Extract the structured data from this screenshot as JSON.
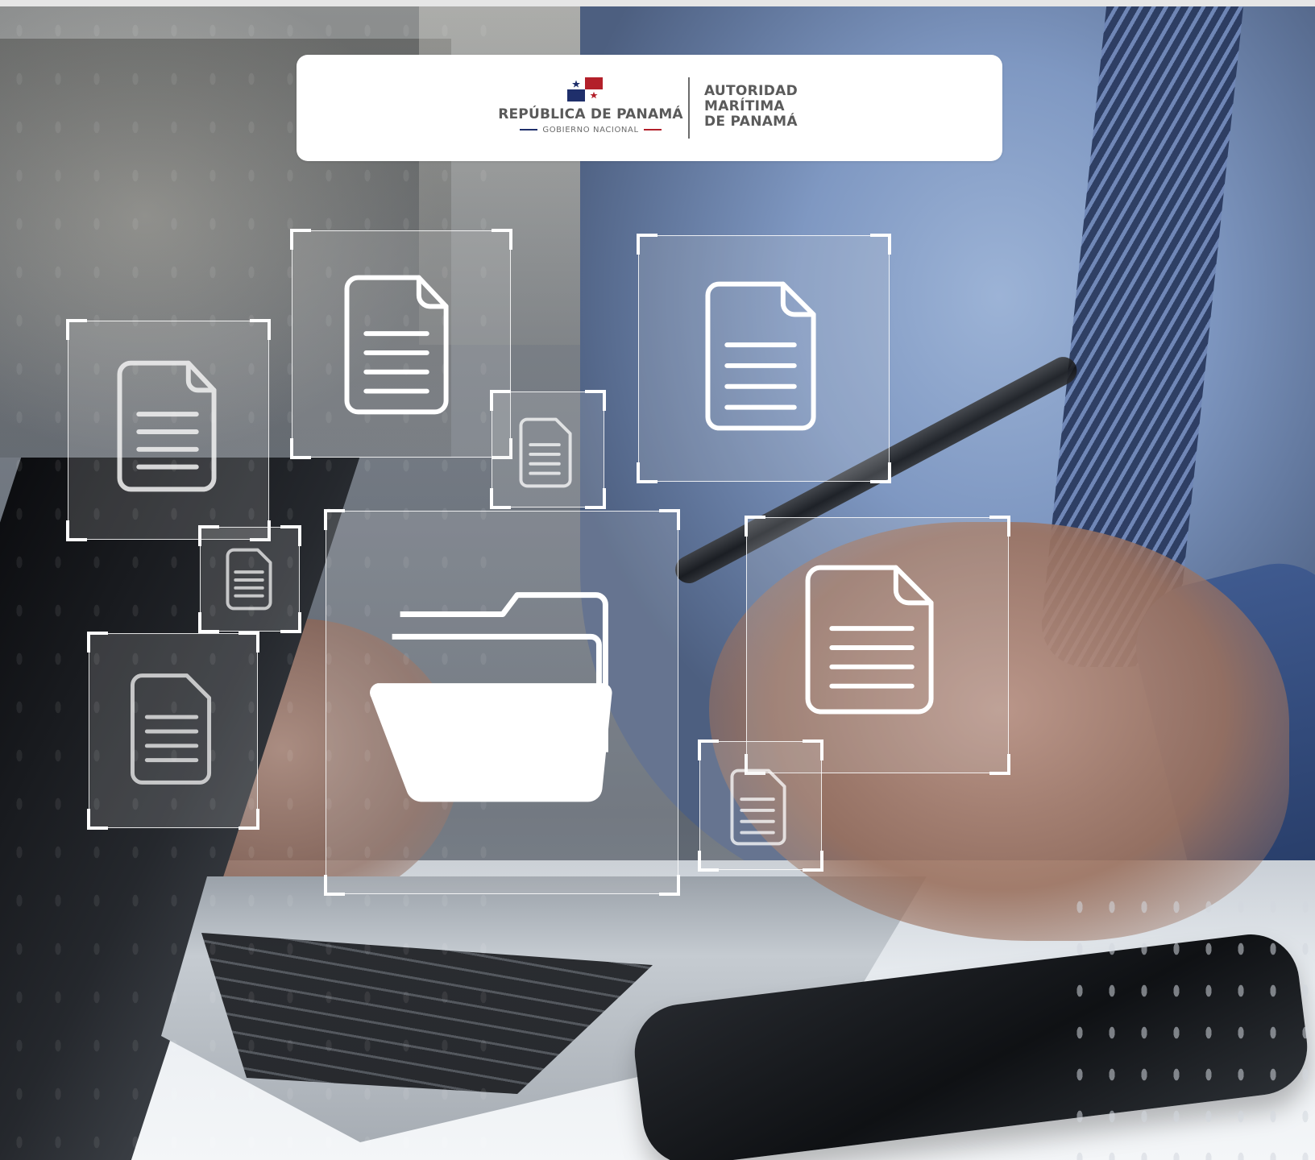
{
  "banner": {
    "government_name": "REPÚBLICA DE PANAMÁ",
    "government_subtitle": "GOBIERNO NACIONAL",
    "authority_lines": [
      "AUTORIDAD",
      "MARÍTIMA",
      "DE PANAMÁ"
    ],
    "flag_colors": {
      "blue": "#1f2f6b",
      "red": "#b3202a",
      "white": "#ffffff"
    }
  },
  "icons": {
    "document": "document-icon",
    "folder": "folder-icon"
  },
  "colors": {
    "hologram": "#ffffff",
    "banner_bg": "#ffffff",
    "banner_text": "#5a5a5a"
  }
}
